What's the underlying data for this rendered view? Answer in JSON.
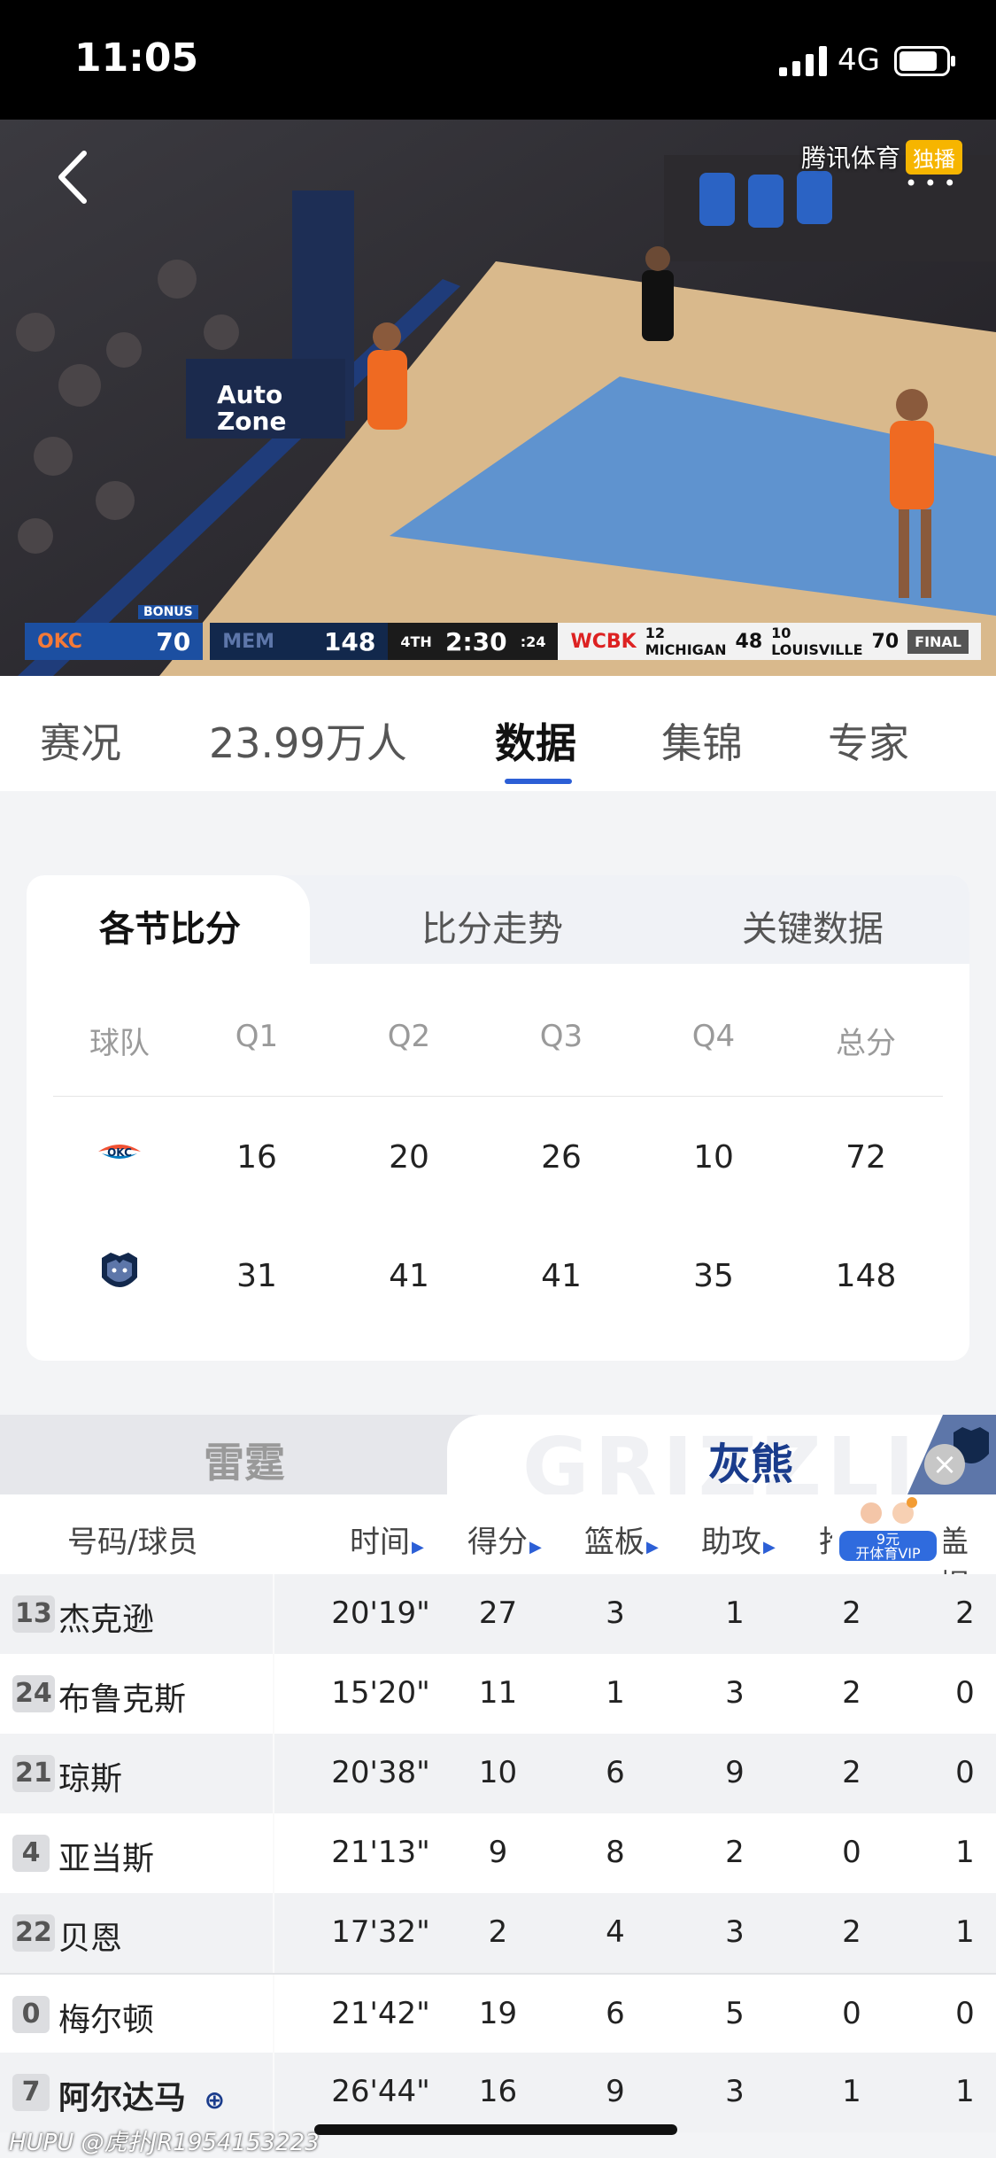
{
  "status_bar": {
    "time": "11:05",
    "network": "4G"
  },
  "video": {
    "broadcaster": "腾讯体育",
    "exclusive_badge": "独播",
    "scorebug": {
      "away_bonus": "BONUS",
      "away_score": "70",
      "home_score": "148",
      "period": "4TH",
      "clock": "2:30",
      "shot_clock": ":24",
      "ticker_label": "WCBK",
      "ticker_team1": "12 MICHIGAN",
      "ticker_score1": "48",
      "ticker_team2": "10 LOUISVILLE",
      "ticker_score2": "70",
      "ticker_status": "FINAL"
    }
  },
  "top_tabs": [
    {
      "label": "赛况"
    },
    {
      "label": "23.99万人"
    },
    {
      "label": "数据"
    },
    {
      "label": "集锦"
    },
    {
      "label": "专家"
    }
  ],
  "quarter_card": {
    "subtabs": [
      "各节比分",
      "比分走势",
      "关键数据"
    ],
    "headers": [
      "球队",
      "Q1",
      "Q2",
      "Q3",
      "Q4",
      "总分"
    ],
    "teams": [
      {
        "logo": "thunder-logo",
        "scores": [
          "16",
          "20",
          "26",
          "10",
          "72"
        ]
      },
      {
        "logo": "grizzlies-logo",
        "scores": [
          "31",
          "41",
          "41",
          "35",
          "148"
        ]
      }
    ]
  },
  "team_toggle": {
    "left": "雷霆",
    "right": "灰熊",
    "watermark": "GRIZZLI"
  },
  "vip_badge": {
    "price": "9元",
    "label": "开体育VIP"
  },
  "player_table": {
    "headers": {
      "player": "号码/球员",
      "time": "时间",
      "points": "得分",
      "rebounds": "篮板",
      "assists": "助攻",
      "steals": "抢",
      "blocks": "盖帽"
    },
    "rows": [
      {
        "num": "13",
        "name": "杰克逊",
        "time": "20'19\"",
        "pts": "27",
        "reb": "3",
        "ast": "1",
        "stl": "2",
        "blk": "2"
      },
      {
        "num": "24",
        "name": "布鲁克斯",
        "time": "15'20\"",
        "pts": "11",
        "reb": "1",
        "ast": "3",
        "stl": "2",
        "blk": "0"
      },
      {
        "num": "21",
        "name": "琼斯",
        "time": "20'38\"",
        "pts": "10",
        "reb": "6",
        "ast": "9",
        "stl": "2",
        "blk": "0"
      },
      {
        "num": "4",
        "name": "亚当斯",
        "time": "21'13\"",
        "pts": "9",
        "reb": "8",
        "ast": "2",
        "stl": "0",
        "blk": "1"
      },
      {
        "num": "22",
        "name": "贝恩",
        "time": "17'32\"",
        "pts": "2",
        "reb": "4",
        "ast": "3",
        "stl": "2",
        "blk": "1"
      },
      {
        "num": "0",
        "name": "梅尔顿",
        "time": "21'42\"",
        "pts": "19",
        "reb": "6",
        "ast": "5",
        "stl": "0",
        "blk": "0"
      },
      {
        "num": "7",
        "name": "阿尔达马",
        "time": "26'44\"",
        "pts": "16",
        "reb": "9",
        "ast": "3",
        "stl": "1",
        "blk": "1"
      }
    ]
  },
  "watermark": "HUPU @虎扑JR1954153223"
}
